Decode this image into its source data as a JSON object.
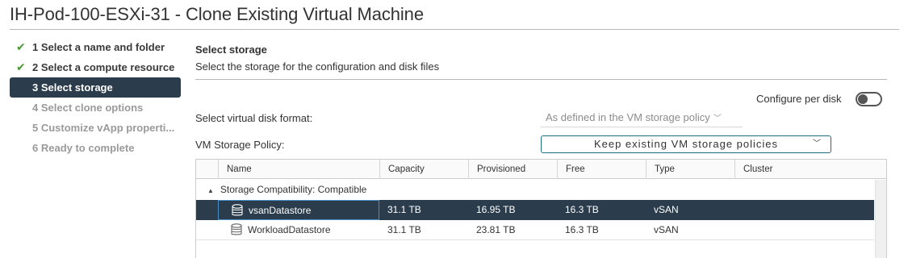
{
  "window": {
    "title": "IH-Pod-100-ESXi-31 - Clone Existing Virtual Machine"
  },
  "steps": [
    {
      "label": "1 Select a name and folder",
      "state": "done"
    },
    {
      "label": "2 Select a compute resource",
      "state": "done"
    },
    {
      "label": "3 Select storage",
      "state": "active"
    },
    {
      "label": "4 Select clone options",
      "state": "pending"
    },
    {
      "label": "5 Customize vApp properti...",
      "state": "pending"
    },
    {
      "label": "6 Ready to complete",
      "state": "pending"
    }
  ],
  "section": {
    "title": "Select storage",
    "description": "Select the storage for the configuration and disk files"
  },
  "configure_per_disk": {
    "label": "Configure per disk",
    "enabled": false
  },
  "disk_format": {
    "label": "Select virtual disk format:",
    "value": "As defined in the VM storage policy"
  },
  "storage_policy": {
    "label": "VM Storage Policy:",
    "value": "Keep existing VM storage policies"
  },
  "grid": {
    "columns": [
      "Name",
      "Capacity",
      "Provisioned",
      "Free",
      "Type",
      "Cluster"
    ],
    "group_label": "Storage Compatibility: Compatible",
    "rows": [
      {
        "name": "vsanDatastore",
        "capacity": "31.1 TB",
        "provisioned": "16.95 TB",
        "free": "16.3 TB",
        "type": "vSAN",
        "cluster": "",
        "selected": true
      },
      {
        "name": "WorkloadDatastore",
        "capacity": "31.1 TB",
        "provisioned": "23.81 TB",
        "free": "16.3 TB",
        "type": "vSAN",
        "cluster": "",
        "selected": false
      }
    ]
  },
  "icons": {
    "completed_step": "check-icon",
    "datastore": "datastore-icon",
    "collapse": "caret-down-icon",
    "dropdown": "chevron-down-icon"
  },
  "colors": {
    "active_bg": "#2b3d4c",
    "check": "#4a9a2f",
    "policy_border": "#1e6f7d"
  }
}
